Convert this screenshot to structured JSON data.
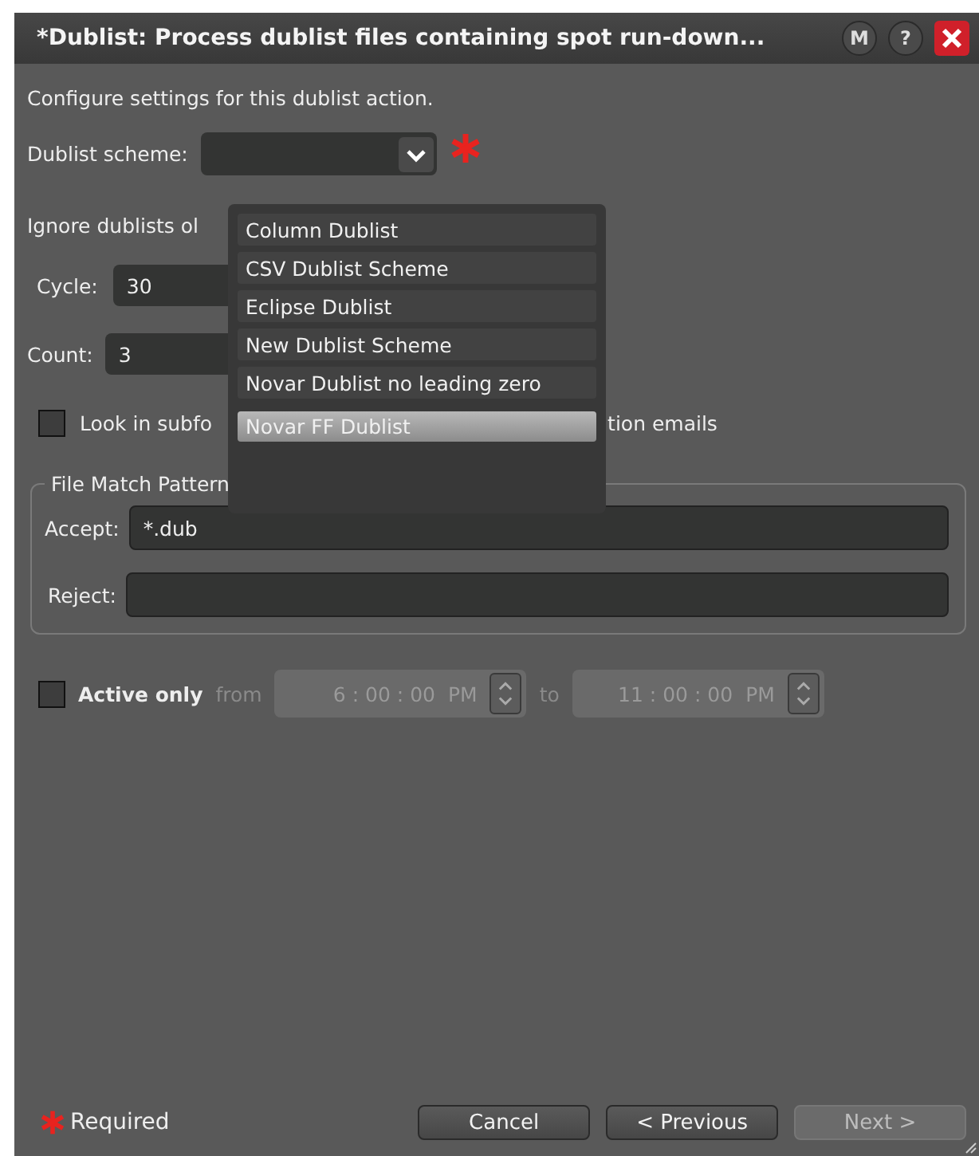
{
  "window": {
    "title": "*Dublist: Process dublist files containing spot run-down...",
    "title_buttons": [
      {
        "label": "M"
      },
      {
        "label": "?"
      }
    ]
  },
  "intro": "Configure settings for this dublist action.",
  "scheme": {
    "label": "Dublist scheme:",
    "required": true,
    "expanded": true,
    "options": [
      {
        "label": "Column Dublist",
        "selected": false
      },
      {
        "label": "CSV Dublist Scheme",
        "selected": false
      },
      {
        "label": "Eclipse Dublist",
        "selected": false
      },
      {
        "label": "New Dublist Scheme",
        "selected": false
      },
      {
        "label": "Novar Dublist no leading zero",
        "selected": false
      },
      {
        "label": "Novar FF Dublist",
        "selected": true
      }
    ]
  },
  "ignore_label": "Ignore dublists ol",
  "cycle": {
    "label": "Cycle:",
    "value": "30"
  },
  "count": {
    "label": "Count:",
    "value": "3"
  },
  "subfolders": {
    "label": "Look in subfo",
    "checked": false
  },
  "emails_label": "tion emails",
  "file_match": {
    "title": "File Match Pattern",
    "accept": {
      "label": "Accept:",
      "value": "*.dub"
    },
    "reject": {
      "label": "Reject:"
    }
  },
  "active_only": {
    "label": "Active only",
    "checked": false,
    "from_label": "from",
    "from": {
      "time": "6 : 00 : 00",
      "ampm": "PM"
    },
    "to_label": "to",
    "to": {
      "time": "11 : 00 : 00",
      "ampm": "PM"
    }
  },
  "footer": {
    "required_label": "Required",
    "buttons": [
      {
        "label": "Cancel",
        "disabled": false
      },
      {
        "label": "< Previous",
        "disabled": false
      },
      {
        "label": "Next >",
        "disabled": true
      }
    ]
  }
}
